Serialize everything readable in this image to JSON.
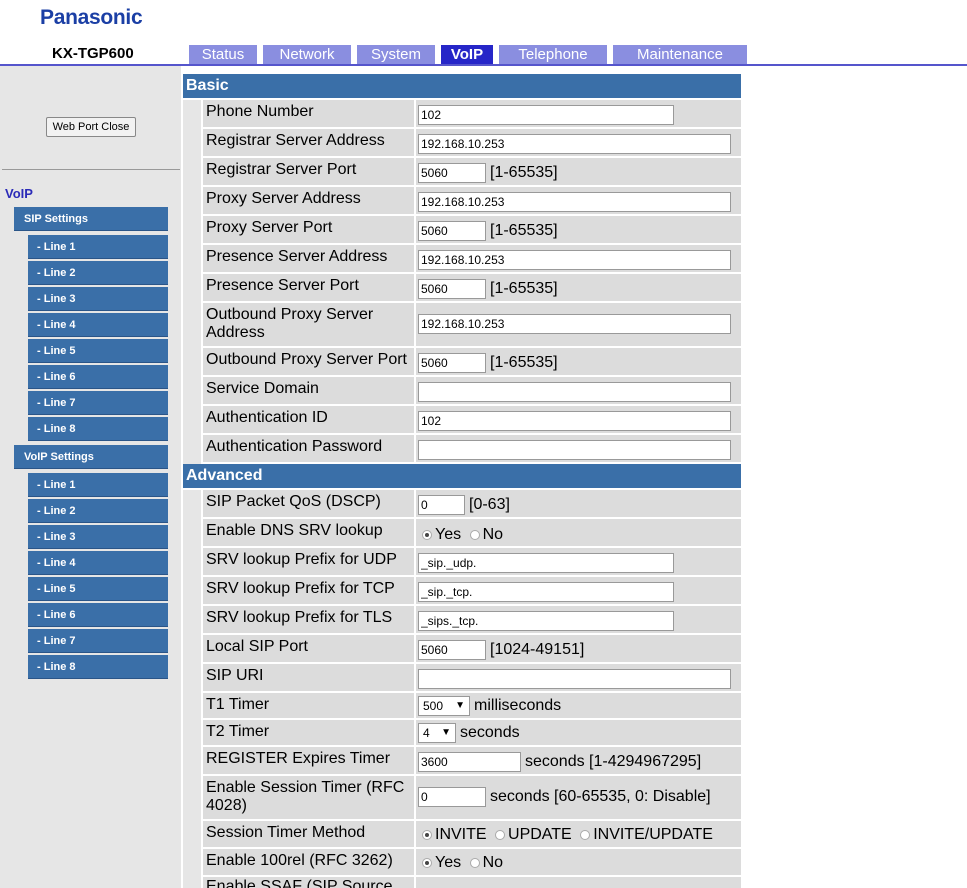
{
  "header": {
    "brand": "Panasonic",
    "model": "KX-TGP600",
    "tabs": [
      {
        "label": "Status"
      },
      {
        "label": "Network"
      },
      {
        "label": "System"
      },
      {
        "label": "VoIP",
        "active": true
      },
      {
        "label": "Telephone"
      },
      {
        "label": "Maintenance"
      }
    ]
  },
  "sidebar": {
    "close_button": "Web Port Close",
    "heading": "VoIP",
    "sip_settings": "SIP Settings",
    "sip_lines": [
      "- Line 1",
      "- Line 2",
      "- Line 3",
      "- Line 4",
      "- Line 5",
      "- Line 6",
      "- Line 7",
      "- Line 8"
    ],
    "voip_settings": "VoIP Settings",
    "voip_lines": [
      "- Line 1",
      "- Line 2",
      "- Line 3",
      "- Line 4",
      "- Line 5",
      "- Line 6",
      "- Line 7",
      "- Line 8"
    ]
  },
  "basic": {
    "title": "Basic",
    "phone_number": {
      "label": "Phone Number",
      "value": "102"
    },
    "registrar_address": {
      "label": "Registrar Server Address",
      "value": "192.168.10.253"
    },
    "registrar_port": {
      "label": "Registrar Server Port",
      "value": "5060",
      "range": "[1-65535]"
    },
    "proxy_address": {
      "label": "Proxy Server Address",
      "value": "192.168.10.253"
    },
    "proxy_port": {
      "label": "Proxy Server Port",
      "value": "5060",
      "range": "[1-65535]"
    },
    "presence_address": {
      "label": "Presence Server Address",
      "value": "192.168.10.253"
    },
    "presence_port": {
      "label": "Presence Server Port",
      "value": "5060",
      "range": "[1-65535]"
    },
    "outbound_address": {
      "label": "Outbound Proxy Server Address",
      "value": "192.168.10.253"
    },
    "outbound_port": {
      "label": "Outbound Proxy Server Port",
      "value": "5060",
      "range": "[1-65535]"
    },
    "service_domain": {
      "label": "Service Domain",
      "value": ""
    },
    "auth_id": {
      "label": "Authentication ID",
      "value": "102"
    },
    "auth_password": {
      "label": "Authentication Password",
      "value": ""
    }
  },
  "advanced": {
    "title": "Advanced",
    "qos": {
      "label": "SIP Packet QoS (DSCP)",
      "value": "0",
      "range": "[0-63]"
    },
    "dns_srv": {
      "label": "Enable DNS SRV lookup",
      "yes": "Yes",
      "no": "No",
      "selected": "Yes"
    },
    "srv_udp": {
      "label": "SRV lookup Prefix for UDP",
      "value": "_sip._udp."
    },
    "srv_tcp": {
      "label": "SRV lookup Prefix for TCP",
      "value": "_sip._tcp."
    },
    "srv_tls": {
      "label": "SRV lookup Prefix for TLS",
      "value": "_sips._tcp."
    },
    "local_port": {
      "label": "Local SIP Port",
      "value": "5060",
      "range": "[1024-49151]"
    },
    "sip_uri": {
      "label": "SIP URI",
      "value": ""
    },
    "t1": {
      "label": "T1 Timer",
      "value": "500",
      "unit": "milliseconds"
    },
    "t2": {
      "label": "T2 Timer",
      "value": "4",
      "unit": "seconds"
    },
    "register_expires": {
      "label": "REGISTER Expires Timer",
      "value": "3600",
      "unit": "seconds [1-4294967295]"
    },
    "session_timer": {
      "label": "Enable Session Timer (RFC 4028)",
      "value": "0",
      "unit": "seconds [60-65535, 0: Disable]"
    },
    "session_method": {
      "label": "Session Timer Method",
      "opt1": "INVITE",
      "opt2": "UPDATE",
      "opt3": "INVITE/UPDATE",
      "selected": "INVITE"
    },
    "rel100": {
      "label": "Enable 100rel (RFC 3262)",
      "yes": "Yes",
      "no": "No",
      "selected": "Yes"
    },
    "ssaf": {
      "label": "Enable SSAF (SIP Source"
    }
  }
}
